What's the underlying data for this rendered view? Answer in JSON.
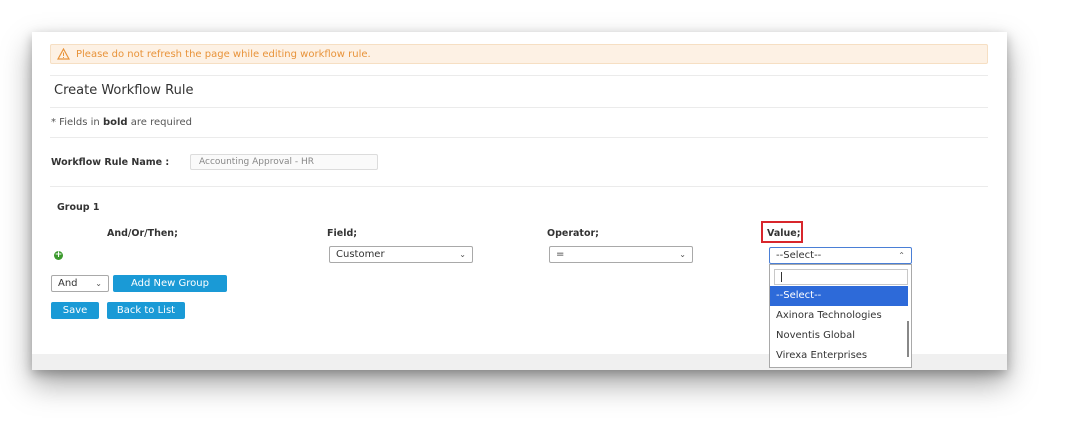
{
  "warning": {
    "icon": "warning-icon",
    "text": "Please do not refresh the page while editing workflow rule."
  },
  "page": {
    "title": "Create Workflow Rule"
  },
  "required_note": {
    "prefix": "* Fields in ",
    "bold": "bold",
    "suffix": " are required"
  },
  "rule_name": {
    "label": "Workflow Rule Name :",
    "value": "Accounting Approval - HR"
  },
  "group": {
    "title": "Group 1",
    "columns": {
      "andor": "And/Or/Then;",
      "field": "Field;",
      "operator": "Operator;",
      "value": "Value;"
    },
    "row": {
      "field_value": "Customer",
      "operator_value": "=",
      "value_selected": "--Select--"
    }
  },
  "connector": {
    "selected": "And"
  },
  "buttons": {
    "add_group": "Add New Group",
    "save": "Save",
    "back": "Back to List"
  },
  "value_dropdown": {
    "search_value": "",
    "options": [
      "--Select--",
      "Axinora Technologies",
      "Noventis Global",
      "Virexa Enterprises"
    ],
    "highlighted_index": 0
  },
  "colors": {
    "accent": "#1a9ad6",
    "warning": "#e8933a",
    "highlight_border": "#d8262c",
    "selected_option": "#2d6ad9"
  }
}
